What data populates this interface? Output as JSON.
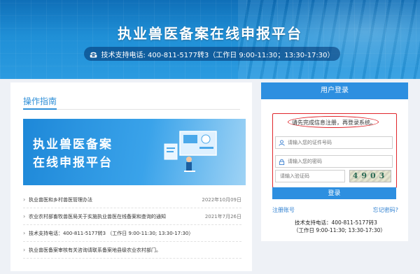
{
  "banner": {
    "title": "执业兽医备案在线申报平台",
    "phone_text": "技术支持电话: 400-811-5177转3（工作日 9:00-11:30；13:30-17:30）"
  },
  "guide": {
    "title": "操作指南",
    "image_line1": "执业兽医备案",
    "image_line2": "在线申报平台",
    "news": [
      {
        "text": "执业兽医和乡村兽医管理办法",
        "date": "2022年10月09日"
      },
      {
        "text": "农业农村部畜牧兽医局关于实施执业兽医在线备案和查询的通知",
        "date": "2021年7月26日"
      },
      {
        "text": "技术支持电话：400-811-5177转3 （工作日 9:00-11:30; 13:30-17:30）",
        "date": ""
      },
      {
        "text": "执业兽医备案审核有关咨询请联系备案地县级农业农村部门。",
        "date": ""
      }
    ]
  },
  "login": {
    "header": "用户登录",
    "notice": "请先完成信息注册，再登录系统。",
    "id_placeholder": "请输入您的证件号码",
    "pwd_placeholder": "请输入您的密码",
    "captcha_placeholder": "请输入验证码",
    "captcha_text": "4903",
    "button": "登录",
    "register": "注册账号",
    "forgot": "忘记密码?",
    "phone": "技术支持电话：400-811-5177转3",
    "hours": "（工作日 9:00-11:30; 13:30-17:30）"
  },
  "colors": {
    "primary": "#2d8fe0",
    "highlight": "#e0262b"
  },
  "icons": [
    "phone-icon",
    "user-icon",
    "lock-icon"
  ]
}
